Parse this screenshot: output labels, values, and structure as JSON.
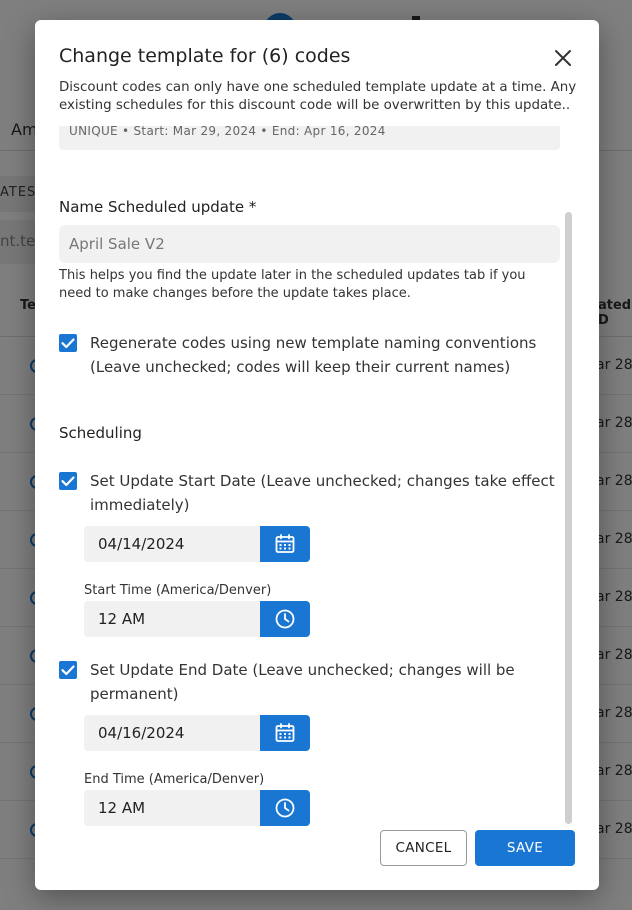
{
  "background": {
    "tab_label": "Am",
    "strip_label": "ATES",
    "search_fragment": "nt.tec",
    "column_left": "Te",
    "column_right": "ated D",
    "row_date": "ar 28,",
    "row_count": 9
  },
  "dialog": {
    "title": "Change template for (6) codes",
    "description": "Discount codes can only have one scheduled template update at a time. Any existing schedules for this discount code will be overwritten by this update..",
    "summary_text": "UNIQUE • Start: Mar 29, 2024 • End: Apr 16, 2024",
    "name_label": "Name Scheduled update *",
    "name_value": "April Sale V2",
    "name_helper": "This helps you find the update later in the scheduled updates tab if you need to make changes before the update takes place.",
    "regenerate": {
      "checked": true,
      "label": "Regenerate codes using new template naming conventions (Leave unchecked; codes will keep their current names)"
    },
    "scheduling_title": "Scheduling",
    "start": {
      "checked": true,
      "label": "Set Update Start Date (Leave unchecked; changes take effect immediately)",
      "date": "04/14/2024",
      "time_label": "Start Time (America/Denver)",
      "time": "12 AM"
    },
    "end": {
      "checked": true,
      "label": "Set Update End Date (Leave unchecked; changes will be permanent)",
      "date": "04/16/2024",
      "time_label": "End Time (America/Denver)",
      "time": "12 AM"
    },
    "cancel_label": "CANCEL",
    "save_label": "SAVE"
  },
  "icons": {
    "close": "close-icon",
    "calendar": "calendar-icon",
    "clock": "clock-icon",
    "check": "check-icon"
  },
  "colors": {
    "accent": "#1976d2",
    "field_bg": "#f1f1f1",
    "scrim": "rgba(0,0,0,0.5)"
  }
}
